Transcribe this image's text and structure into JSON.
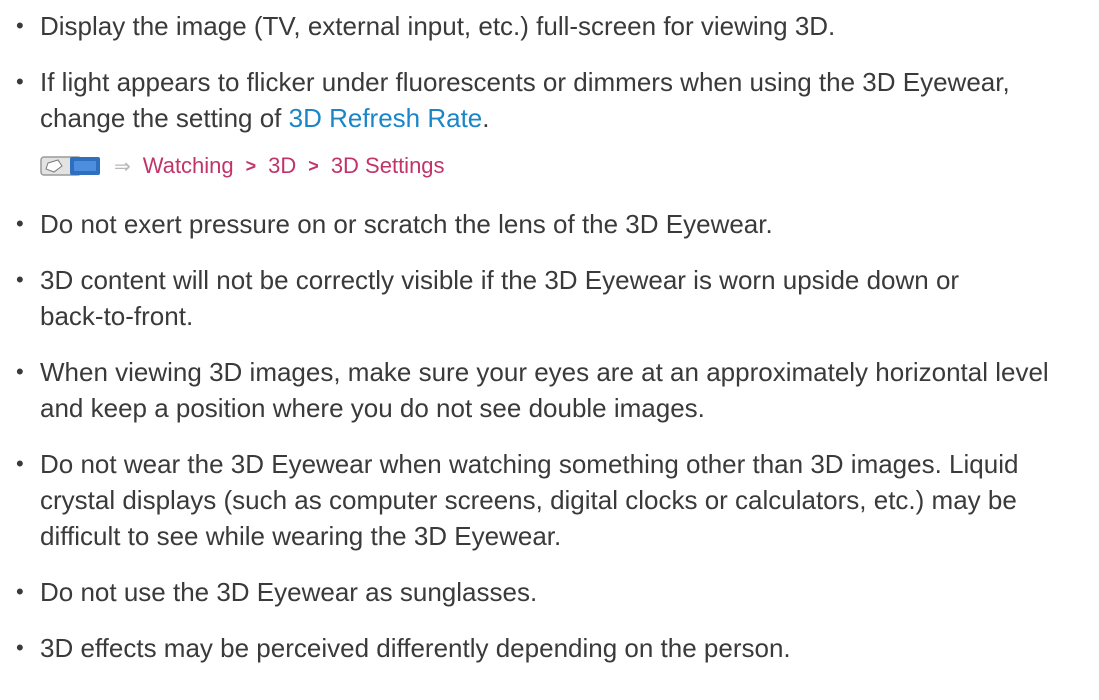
{
  "items": [
    {
      "text": "Display the image (TV, external input, etc.) full-screen for viewing 3D."
    },
    {
      "text_before": "If light appears to flicker under fluorescents or dimmers when using the 3D Eyewear, change the setting of ",
      "link": "3D Refresh Rate",
      "text_after": "."
    },
    {
      "text": "Do not exert pressure on or scratch the lens of the 3D Eyewear."
    },
    {
      "text": "3D content will not be correctly visible if the 3D Eyewear is worn upside down or back-to-front."
    },
    {
      "text": "When viewing 3D images, make sure your eyes are at an approximately horizontal level and keep a position where you do not see double images."
    },
    {
      "text": "Do not wear the 3D Eyewear when watching something other than 3D images. Liquid crystal displays (such as computer screens, digital clocks or calculators, etc.) may be difficult to see while wearing the 3D Eyewear."
    },
    {
      "text": "Do not use the 3D Eyewear as sunglasses."
    },
    {
      "text": "3D effects may be perceived differently depending on the person."
    }
  ],
  "bullet_char": "•",
  "menu_path": {
    "icon": "menu-remote-icon",
    "arrow": "⇒",
    "separator": ">",
    "steps": [
      "Watching",
      "3D",
      "3D Settings"
    ]
  },
  "colors": {
    "text": "#3a3a3a",
    "link": "#1a86c8",
    "path": "#c2336a"
  }
}
